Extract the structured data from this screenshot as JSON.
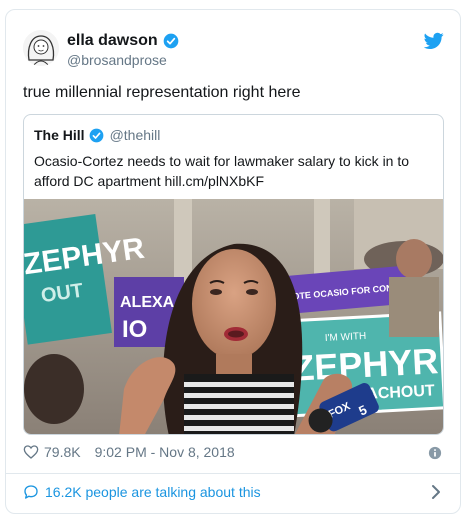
{
  "tweet": {
    "author_name": "ella dawson",
    "author_handle": "@brosandprose",
    "text": "true millennial representation right here",
    "likes": "79.8K",
    "timestamp": "9:02 PM - Nov 8, 2018",
    "talking": "16.2K people are talking about this"
  },
  "quote": {
    "author_name": "The Hill",
    "author_handle": "@thehill",
    "text": "Ocasio-Cortez needs to wait for lawmaker salary to kick in to afford DC apartment hill.cm/plNXbKF"
  },
  "photo": {
    "sign_left": "ZEPHYR",
    "sign_left_2": "OUT",
    "sign_center": "ALEXA",
    "sign_center_2": "IO",
    "sign_purple": "VOTE OCASIO FOR CONGRESS",
    "sign_right_top": "I'M WITH",
    "sign_right": "ZEPHYR",
    "sign_right_2": "TEACHOUT",
    "mic_brand": "FOX",
    "mic_number": "5"
  },
  "icons": {
    "verified": "verified-badge-icon",
    "twitter": "twitter-bird-icon",
    "heart": "heart-icon",
    "info": "info-icon",
    "bubble": "speech-bubble-icon",
    "chevron": "chevron-right-icon"
  },
  "colors": {
    "accent": "#1da1f2",
    "link": "#1b95e0",
    "muted": "#657786",
    "border": "#e1e8ed"
  }
}
